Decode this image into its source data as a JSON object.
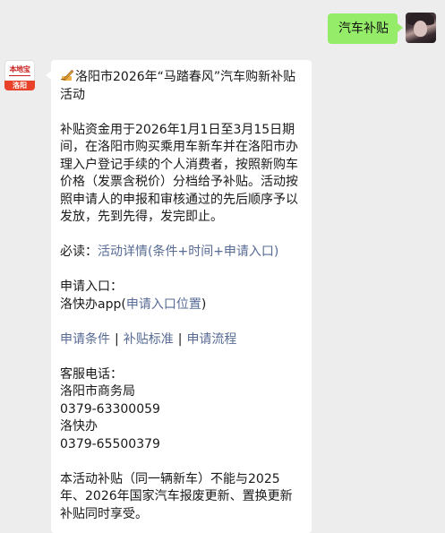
{
  "outgoing": {
    "text": "汽车补贴"
  },
  "brand_avatar": {
    "top": "本地宝",
    "bottom": "洛阳"
  },
  "message": {
    "title": "洛阳市2026年“马踏春风”汽车购新补贴活动",
    "intro": "补贴资金用于2026年1月1日至3月15日期间，在洛阳市购买乘用车新车并在洛阳市办理入户登记手续的个人消费者，按照新购车价格（发票含税价）分档给予补贴。活动按照申请人的申报和审核通过的先后顺序予以发放，先到先得，发完即止。",
    "must_read_label": "必读：",
    "must_read_link": "活动详情(条件+时间+申请入口)",
    "apply_entry_label": "申请入口：",
    "apply_app_prefix": "洛快办app(",
    "apply_app_link": "申请入口位置",
    "apply_app_suffix": ")",
    "quick_links": [
      "申请条件",
      "补贴标准",
      "申请流程"
    ],
    "link_separator": "|",
    "service_label": "客服电话：",
    "service_1_name": "洛阳市商务局",
    "service_1_phone": "0379-63300059",
    "service_2_name": "洛快办",
    "service_2_phone": "0379-65500379",
    "note": "本活动补贴（同一辆新车）不能与2025年、2026年国家汽车报废更新、置换更新补贴同时享受。"
  }
}
